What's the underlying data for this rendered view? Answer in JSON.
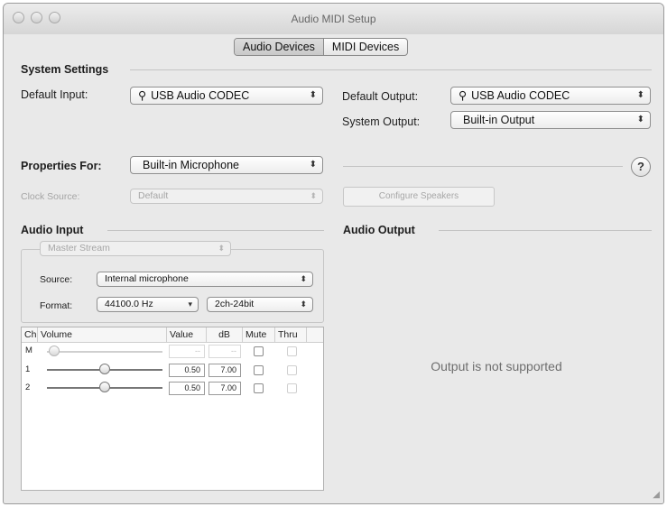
{
  "window": {
    "title": "Audio MIDI Setup"
  },
  "tabs": [
    {
      "label": "Audio Devices",
      "selected": true
    },
    {
      "label": "MIDI Devices",
      "selected": false
    }
  ],
  "system_settings": {
    "heading": "System Settings",
    "default_input_label": "Default Input:",
    "default_input_value": "USB Audio CODEC",
    "default_output_label": "Default Output:",
    "default_output_value": "USB Audio CODEC",
    "system_output_label": "System Output:",
    "system_output_value": "Built-in Output"
  },
  "properties": {
    "label": "Properties For:",
    "value": "Built-in Microphone",
    "help_glyph": "?"
  },
  "clock": {
    "label": "Clock Source:",
    "value": "Default",
    "configure_speakers_label": "Configure Speakers"
  },
  "audio_input": {
    "heading": "Audio Input",
    "stream_value": "Master Stream",
    "source_label": "Source:",
    "source_value": "Internal microphone",
    "format_label": "Format:",
    "sample_rate_value": "44100.0 Hz",
    "bit_format_value": "2ch-24bit",
    "table": {
      "headers": {
        "ch": "Ch",
        "volume": "Volume",
        "value": "Value",
        "db": "dB",
        "mute": "Mute",
        "thru": "Thru"
      },
      "rows": [
        {
          "ch": "M",
          "value": "--",
          "db": "--",
          "level": 0.0,
          "enabled": false
        },
        {
          "ch": "1",
          "value": "0.50",
          "db": "7.00",
          "level": 0.5,
          "enabled": true
        },
        {
          "ch": "2",
          "value": "0.50",
          "db": "7.00",
          "level": 0.5,
          "enabled": true
        }
      ]
    }
  },
  "audio_output": {
    "heading": "Audio Output",
    "message": "Output is not supported"
  },
  "icons": {
    "usb": "usb-icon",
    "apple": "apple-icon",
    "popup_arrows": "updown-arrows-icon",
    "resize": "resize-grip-icon"
  }
}
